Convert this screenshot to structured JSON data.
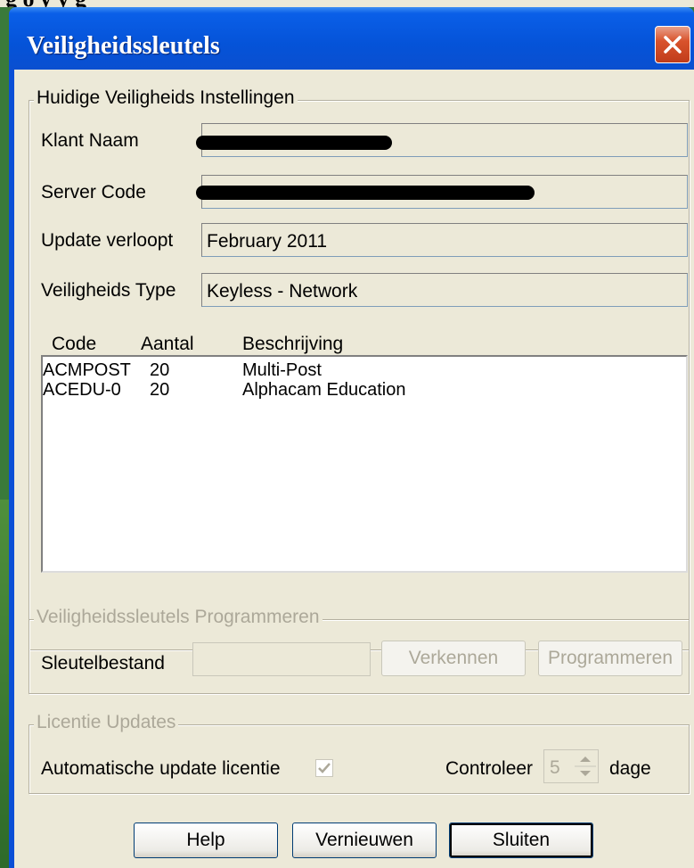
{
  "window": {
    "title": "Veiligheidssleutels",
    "background_partial_text": "g    o    y   y     g"
  },
  "current_settings": {
    "legend": "Huidige Veiligheids Instellingen",
    "customer_name_label": "Klant Naam",
    "server_code_label": "Server Code",
    "update_expires_label": "Update verloopt",
    "update_expires_value": "February 2011",
    "security_type_label": "Veiligheids Type",
    "security_type_value": "Keyless - Network"
  },
  "licenses": {
    "columns": [
      "Code",
      "Aantal",
      "Beschrijving"
    ],
    "rows": [
      {
        "code": "ACMPOST",
        "count": "20",
        "description": "Multi-Post"
      },
      {
        "code": "ACEDU-0",
        "count": "20",
        "description": "Alphacam Education"
      }
    ]
  },
  "program_keys": {
    "legend": "Veiligheidssleutels Programmeren",
    "key_file_label": "Sleutelbestand",
    "key_file_value": "",
    "browse_label": "Verkennen",
    "program_label": "Programmeren"
  },
  "license_updates": {
    "legend": "Licentie Updates",
    "auto_update_label": "Automatische update licentie",
    "auto_update_checked": true,
    "check_label": "Controleer",
    "check_days_value": "5",
    "days_label": "dage"
  },
  "buttons": {
    "help": "Help",
    "refresh": "Vernieuwen",
    "close": "Sluiten"
  },
  "colors": {
    "titlebar": "#0553d8",
    "dialog": "#ece9d8",
    "disabled_text": "#aca899",
    "close_button": "#d9532c"
  }
}
